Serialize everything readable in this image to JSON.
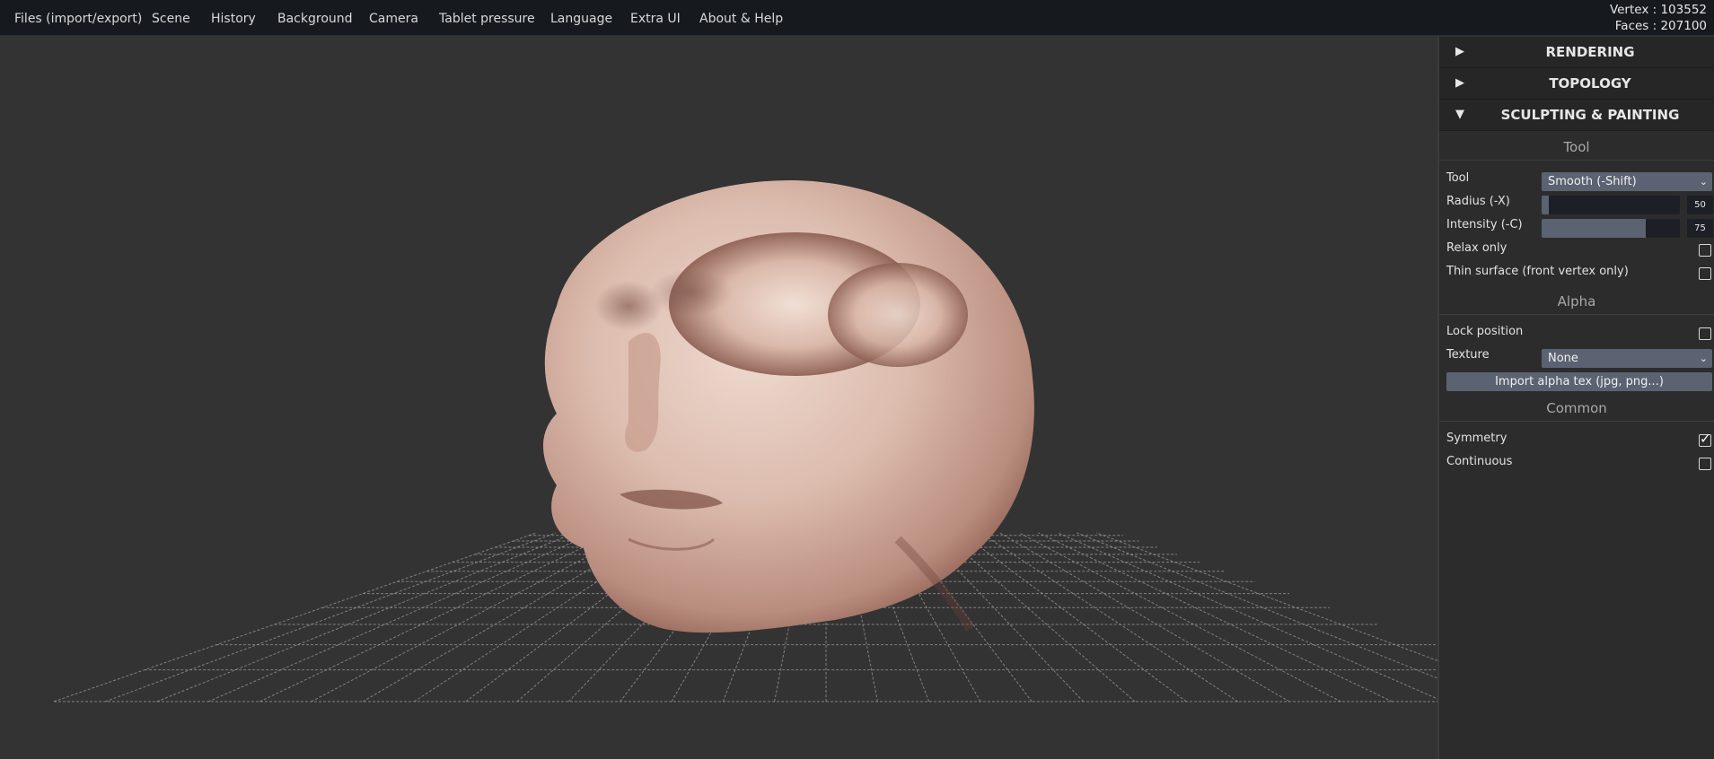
{
  "menu": {
    "items": [
      "Files (import/export)",
      "Scene",
      "History",
      "Background",
      "Camera",
      "Tablet pressure",
      "Language",
      "Extra UI",
      "About & Help"
    ]
  },
  "stats": {
    "vertex": "Vertex : 103552",
    "faces": "Faces : 207100"
  },
  "panel": {
    "folders": [
      {
        "title": "RENDERING",
        "expanded": false,
        "arrow": "▶"
      },
      {
        "title": "TOPOLOGY",
        "expanded": false,
        "arrow": "▶"
      },
      {
        "title": "SCULPTING & PAINTING",
        "expanded": true,
        "arrow": "▼"
      }
    ],
    "sections": {
      "tool": "Tool",
      "alpha": "Alpha",
      "common": "Common"
    },
    "tool": {
      "label": "Tool",
      "value": "Smooth (-Shift)"
    },
    "radius": {
      "label": "Radius (-X)",
      "value": "50",
      "fraction": 0.05
    },
    "intensity": {
      "label": "Intensity (-C)",
      "value": "75",
      "fraction": 0.75
    },
    "relax_only": {
      "label": "Relax only",
      "checked": false
    },
    "thin_surface": {
      "label": "Thin surface (front vertex only)",
      "checked": false
    },
    "lock_position": {
      "label": "Lock position",
      "checked": false
    },
    "texture": {
      "label": "Texture",
      "value": "None"
    },
    "import_alpha": {
      "label": "Import alpha tex (jpg, png...)"
    },
    "symmetry": {
      "label": "Symmetry",
      "checked": true
    },
    "continuous": {
      "label": "Continuous",
      "checked": false
    },
    "check_glyph": "✓",
    "chevron_glyph": "⌄"
  },
  "colors": {
    "background": "#333333",
    "menubar": "#161a1f",
    "panel": "#2c2c2c",
    "control": "#5b6271",
    "track": "#1c2026",
    "grid": "#9a9a9a",
    "skin": "#d6b4a6"
  },
  "icons": {
    "collapsed": "triangle-right-icon",
    "expanded": "triangle-down-icon",
    "dropdown": "chevron-down-icon",
    "check": "checkmark-icon"
  }
}
